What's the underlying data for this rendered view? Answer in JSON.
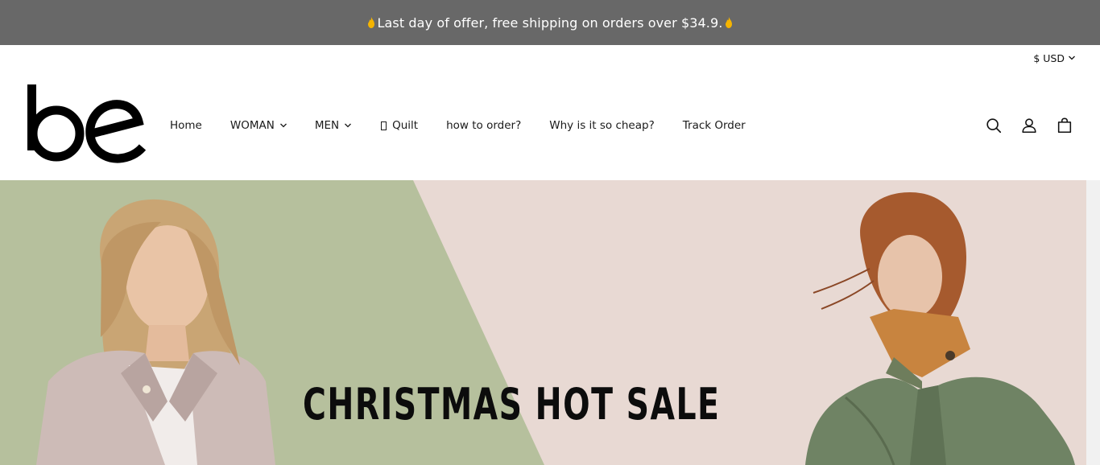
{
  "announcement": {
    "text": "Last day of offer, free shipping on orders over $34.9.",
    "icon": "flame-icon"
  },
  "header": {
    "currency": "$ USD",
    "logo_text": "be"
  },
  "nav": {
    "home": "Home",
    "woman": "WOMAN",
    "men": "MEN",
    "quilt": "Quilt",
    "how_to_order": "how to order?",
    "why_cheap": "Why is it so cheap?",
    "track_order": "Track Order"
  },
  "icons": [
    "search-icon",
    "account-icon",
    "cart-icon"
  ],
  "hero": {
    "title": "CHRISTMAS HOT SALE"
  },
  "colors": {
    "announcement_bg": "#686868",
    "hero_green": "#b6c09d",
    "hero_pink": "#e8d9d3"
  }
}
